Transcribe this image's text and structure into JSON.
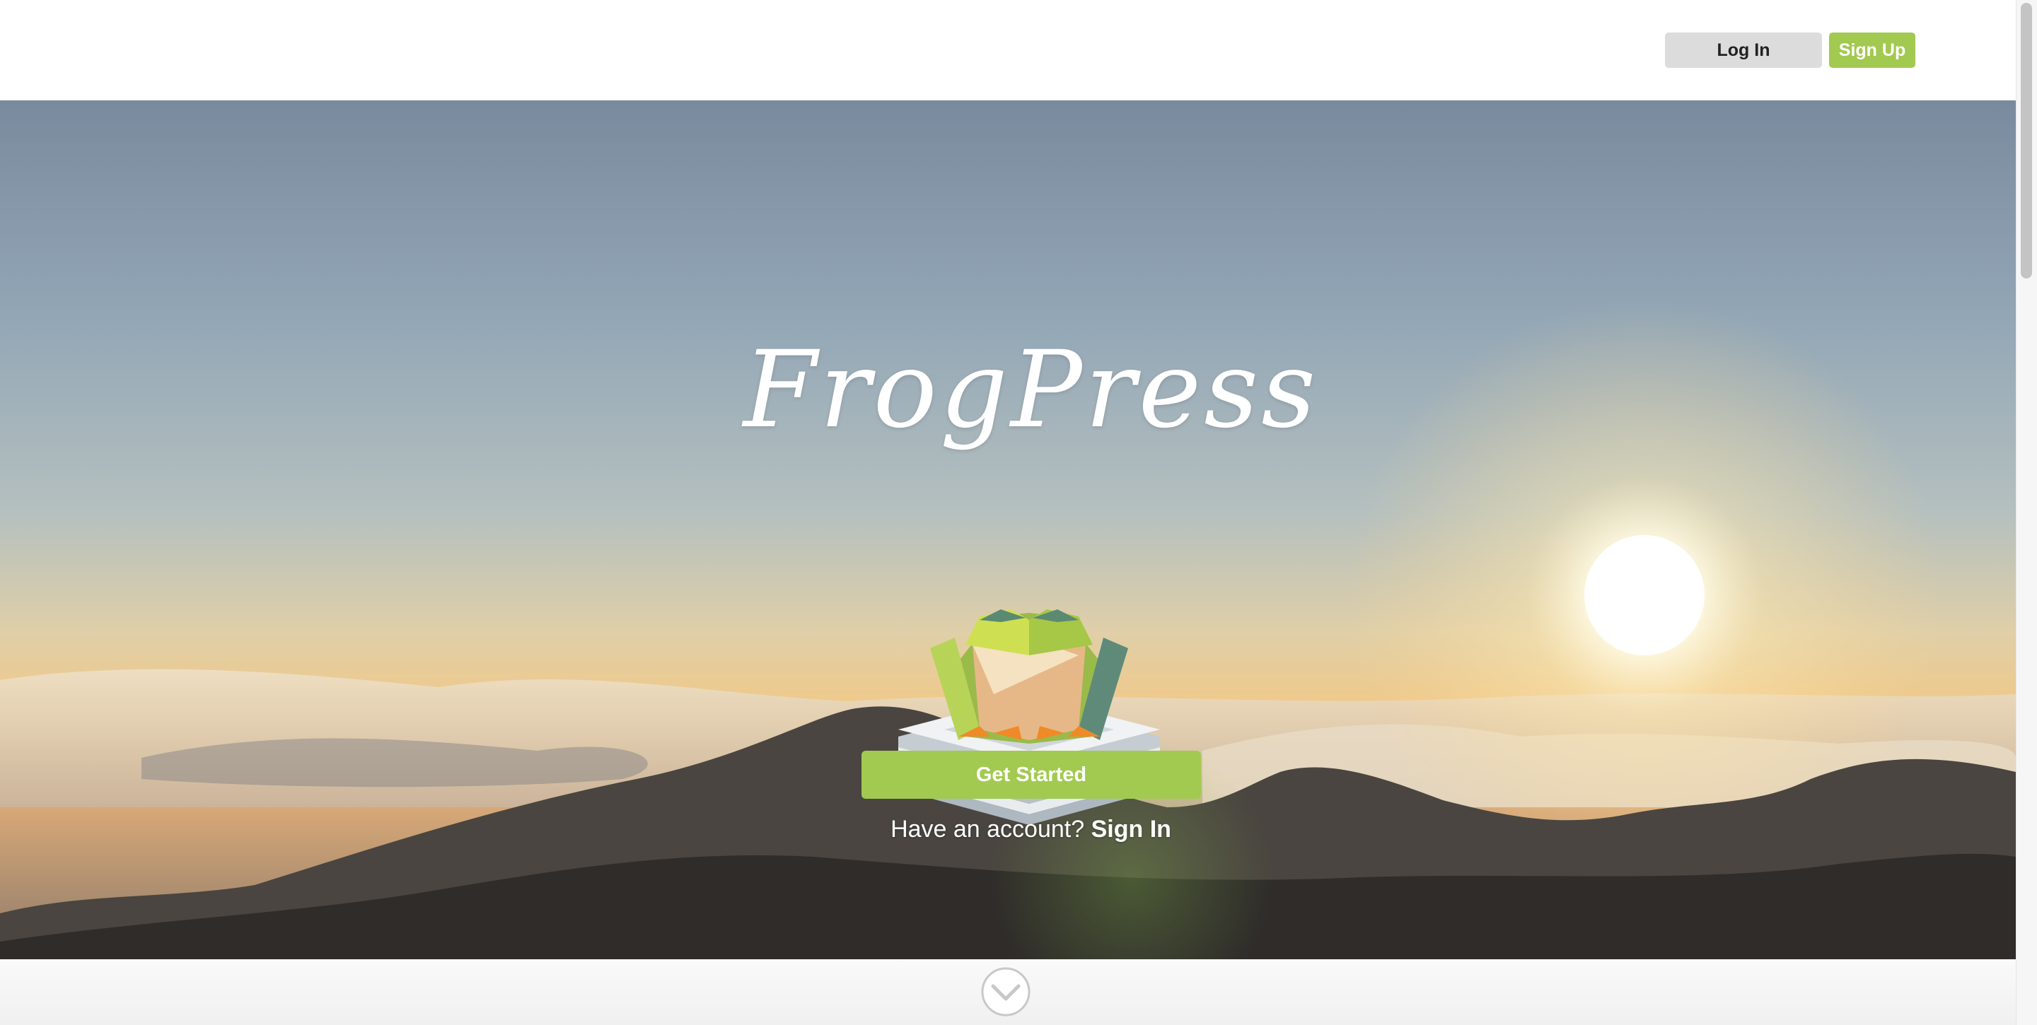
{
  "header": {
    "login_label": "Log In",
    "signup_label": "Sign Up"
  },
  "hero": {
    "brand_name": "FrogPress",
    "cta_label": "Get Started",
    "account_prompt": "Have an account?",
    "signin_label": "Sign In"
  },
  "icons": {
    "scroll": "chevron-down-icon",
    "logo": "frog-on-newspapers-logo"
  },
  "colors": {
    "accent_green": "#a2c950",
    "login_gray": "#dcdcdc"
  }
}
